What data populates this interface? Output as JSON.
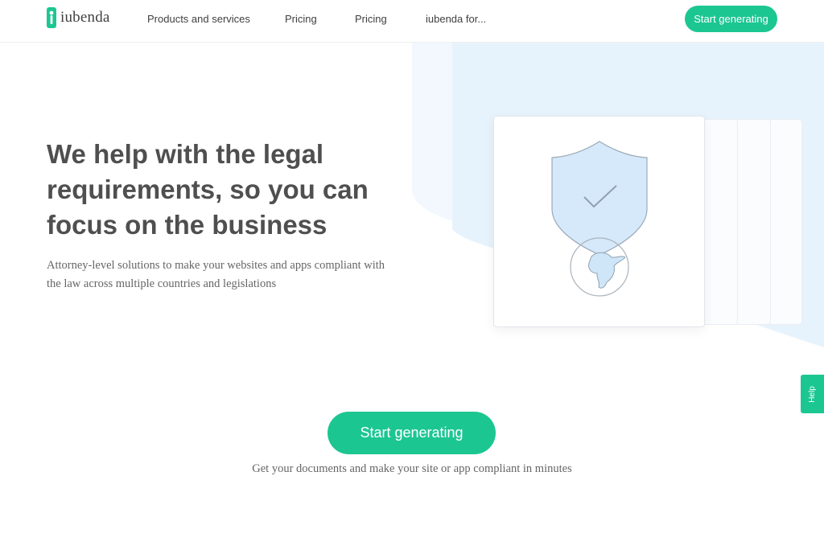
{
  "brand": {
    "name": "iubenda",
    "accent": "#1cc691"
  },
  "nav": {
    "items": [
      {
        "label": "Products and services"
      },
      {
        "label": "Pricing"
      },
      {
        "label": "Pricing"
      },
      {
        "label": "iubenda for..."
      }
    ],
    "cta_label": "Start generating"
  },
  "hero": {
    "title": "We help with the legal requirements, so you can focus on the business",
    "subtitle": "Attorney-level solutions to make your websites and apps compliant with the law across multiple countries and legislations",
    "illustration_icons": [
      "shield-check-icon",
      "globe-icon"
    ]
  },
  "cta": {
    "label": "Start generating",
    "note": "Get your documents and make your site or app compliant in minutes"
  },
  "help_tab": {
    "label": "Help"
  }
}
